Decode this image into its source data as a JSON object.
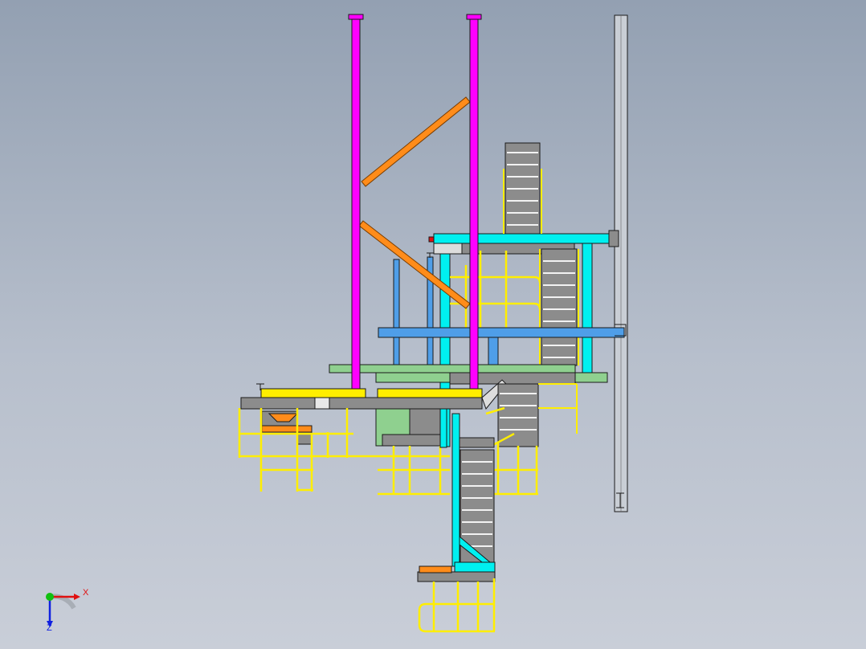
{
  "viewport": {
    "background_top": "#93a0b2",
    "background_bottom": "#c9ced8"
  },
  "colors": {
    "magenta_column": "#ff00ff",
    "orange_brace": "#ff8c1a",
    "cyan_frame": "#00f0f0",
    "blue_beam": "#4f9ee8",
    "green_beam": "#8fd08f",
    "yellow_rail": "#ffee00",
    "gray_deck": "#8c8c8c",
    "edge": "#1a1a1a"
  },
  "orientation_triad": {
    "x_label": "X",
    "z_label": "Z",
    "x_color": "#e01010",
    "y_color": "#10c010",
    "z_color": "#1020e0"
  }
}
